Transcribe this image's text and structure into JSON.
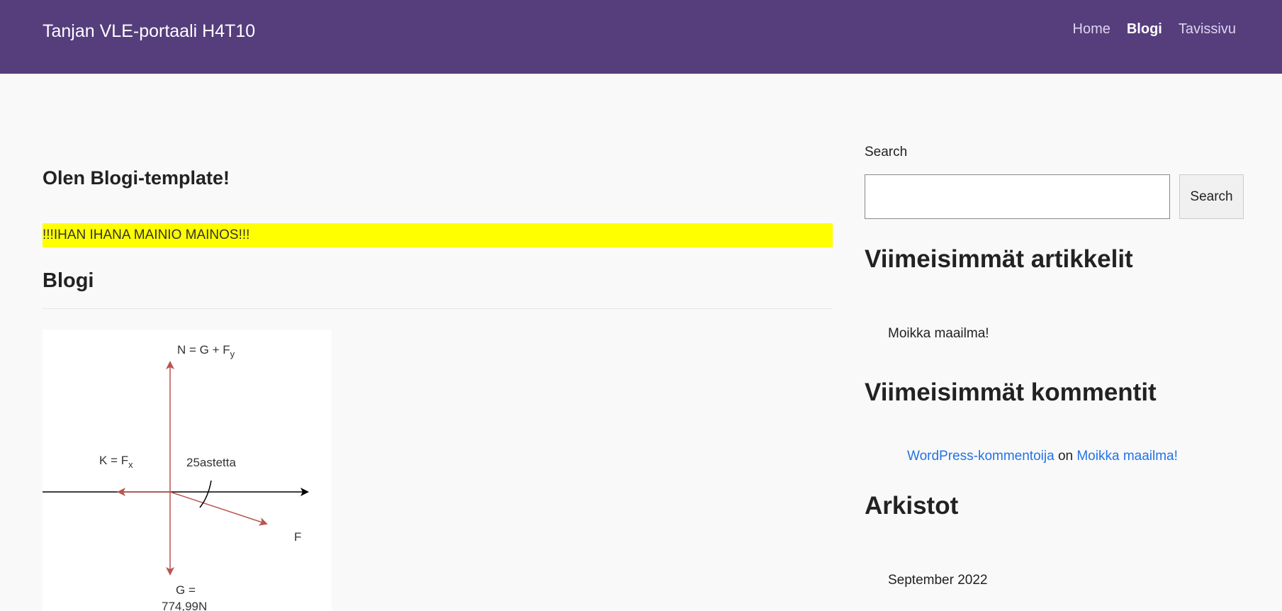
{
  "header": {
    "site_title": "Tanjan VLE-portaali H4T10",
    "nav": [
      {
        "label": "Home",
        "active": false
      },
      {
        "label": "Blogi",
        "active": true
      },
      {
        "label": "Tavissivu",
        "active": false
      }
    ]
  },
  "main": {
    "page_heading": "Olen Blogi-template!",
    "ad_banner": "!!!IHAN IHANA MAINIO MAINOS!!!",
    "section_title": "Blogi",
    "figure": {
      "normal_label": "N = G + F",
      "normal_sub": "y",
      "friction_label": "K = F",
      "friction_sub": "x",
      "angle_label": "25astetta",
      "force_label": "F",
      "gravity_label_line1": "G =",
      "gravity_label_line2": "774,99N"
    }
  },
  "sidebar": {
    "search_label": "Search",
    "search_value": "",
    "search_button": "Search",
    "recent_posts_title": "Viimeisimmät artikkelit",
    "recent_posts": [
      "Moikka maailma!"
    ],
    "recent_comments_title": "Viimeisimmät kommentit",
    "comment_author": "WordPress-kommentoija",
    "comment_on": "on",
    "comment_post": "Moikka maailma!",
    "archives_title": "Arkistot",
    "archives": [
      "September 2022"
    ]
  },
  "colors": {
    "header_bg": "#563d7c",
    "ad_bg": "#ffff00",
    "link": "#2273e6",
    "vector_red": "#b85450"
  }
}
